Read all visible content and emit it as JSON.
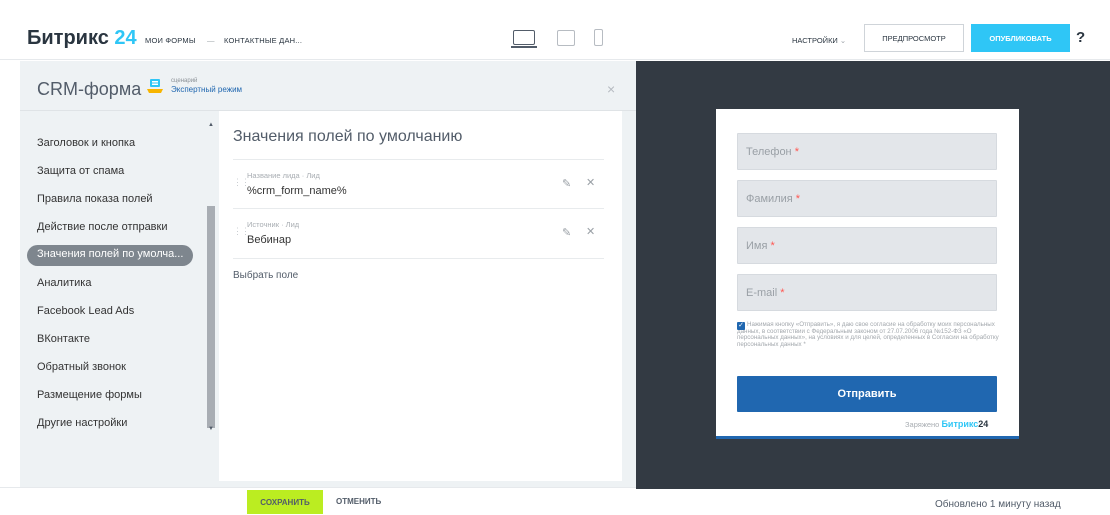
{
  "header": {
    "logo_text": "Битрикс",
    "logo_number": "24",
    "breadcrumbs": [
      "Мои формы",
      "Контактные дан..."
    ],
    "breadcrumb_separator": "—",
    "device_icons": [
      "laptop-icon",
      "tablet-icon",
      "phone-icon"
    ],
    "settings_label": "Настройки",
    "settings_arrow": "⌄",
    "preview_label": "Предпросмотр",
    "publish_label": "Опубликовать",
    "help_label": "?"
  },
  "panel": {
    "title": "CRM-форма",
    "scenario_label": "сценарий",
    "scenario_mode": "Экспертный режим",
    "close_label": "×"
  },
  "sidebar": {
    "items": [
      {
        "label": "Заголовок и кнопка"
      },
      {
        "label": "Защита от спама"
      },
      {
        "label": "Правила показа полей"
      },
      {
        "label": "Действие после отправки"
      },
      {
        "label": "Значения полей по умолча...",
        "active": true
      },
      {
        "label": "Аналитика"
      },
      {
        "label": "Facebook Lead Ads"
      },
      {
        "label": "ВКонтакте"
      },
      {
        "label": "Обратный звонок"
      },
      {
        "label": "Размещение формы"
      },
      {
        "label": "Другие настройки"
      }
    ]
  },
  "content": {
    "heading": "Значения полей по умолчанию",
    "fields": [
      {
        "label": "Название лида · Лид",
        "value": "%crm_form_name%"
      },
      {
        "label": "Источник · Лид",
        "value": "Вебинар"
      }
    ],
    "pick_field": "Выбрать поле"
  },
  "footer": {
    "save_label": "Сохранить",
    "cancel_label": "Отменить",
    "updated": "Обновлено 1 минуту назад"
  },
  "preview_form": {
    "fields": [
      {
        "placeholder": "Телефон",
        "required": "*"
      },
      {
        "placeholder": "Фамилия",
        "required": "*"
      },
      {
        "placeholder": "Имя",
        "required": "*"
      },
      {
        "placeholder": "E-mail",
        "required": "*"
      }
    ],
    "consent_text": "Нажимая кнопку «Отправить», я даю свое согласие на обработку моих персональных данных, в соответствии с Федеральным законом от 27.07.2006 года №152-ФЗ «О персональных данных», на условиях и для целей, определенных в Согласии на обработку персональных данных *",
    "consent_checked": true,
    "submit_label": "Отправить",
    "charged_label": "Заряжено",
    "charged_brand": "Битрикс",
    "charged_number": "24"
  },
  "colors": {
    "accent_blue": "#2fc6f6",
    "form_blue": "#2067b0",
    "save_green": "#bbed21",
    "preview_bg": "#333a43"
  }
}
